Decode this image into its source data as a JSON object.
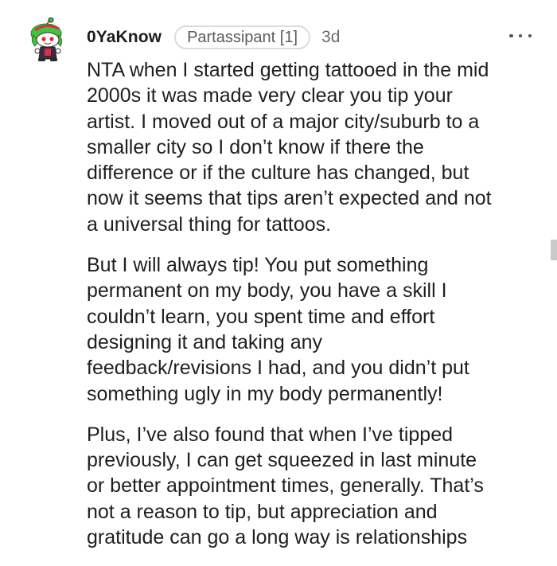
{
  "comment": {
    "username": "0YaKnow",
    "flair": "Partassipant [1]",
    "age": "3d",
    "menu_icon": "more-horizontal-icon",
    "avatar_icon": "snoo-avatar-icon",
    "paragraphs": [
      {
        "lines": [
          "NTA when I started getting tattooed in the mid",
          "2000s it was made very clear you tip your",
          "artist. I moved out of a major city/suburb to a",
          "smaller city so I don’t know if there the",
          "difference or if the culture has changed, but",
          "now it seems that tips aren’t expected and not",
          "a universal thing for tattoos."
        ]
      },
      {
        "lines": [
          "But I will always tip! You put something",
          "permanent on my body, you have a skill I",
          "couldn’t learn, you spent time and effort",
          "designing it and taking any",
          "feedback/revisions I had, and you didn’t put",
          "something ugly in my body permanently!"
        ]
      },
      {
        "lines": [
          "Plus, I’ve also found that when I’ve tipped",
          "previously, I can get squeezed in last minute",
          "or better appointment times, generally. That’s",
          "not a reason to tip, but appreciation and",
          "gratitude can go a long way is relationships"
        ]
      }
    ]
  },
  "colors": {
    "text": "#1f1f1f",
    "meta": "#6b6b6b",
    "flair_border": "#dcdcdc",
    "avatar_green": "#3fbf3f",
    "avatar_red": "#d9303b"
  }
}
